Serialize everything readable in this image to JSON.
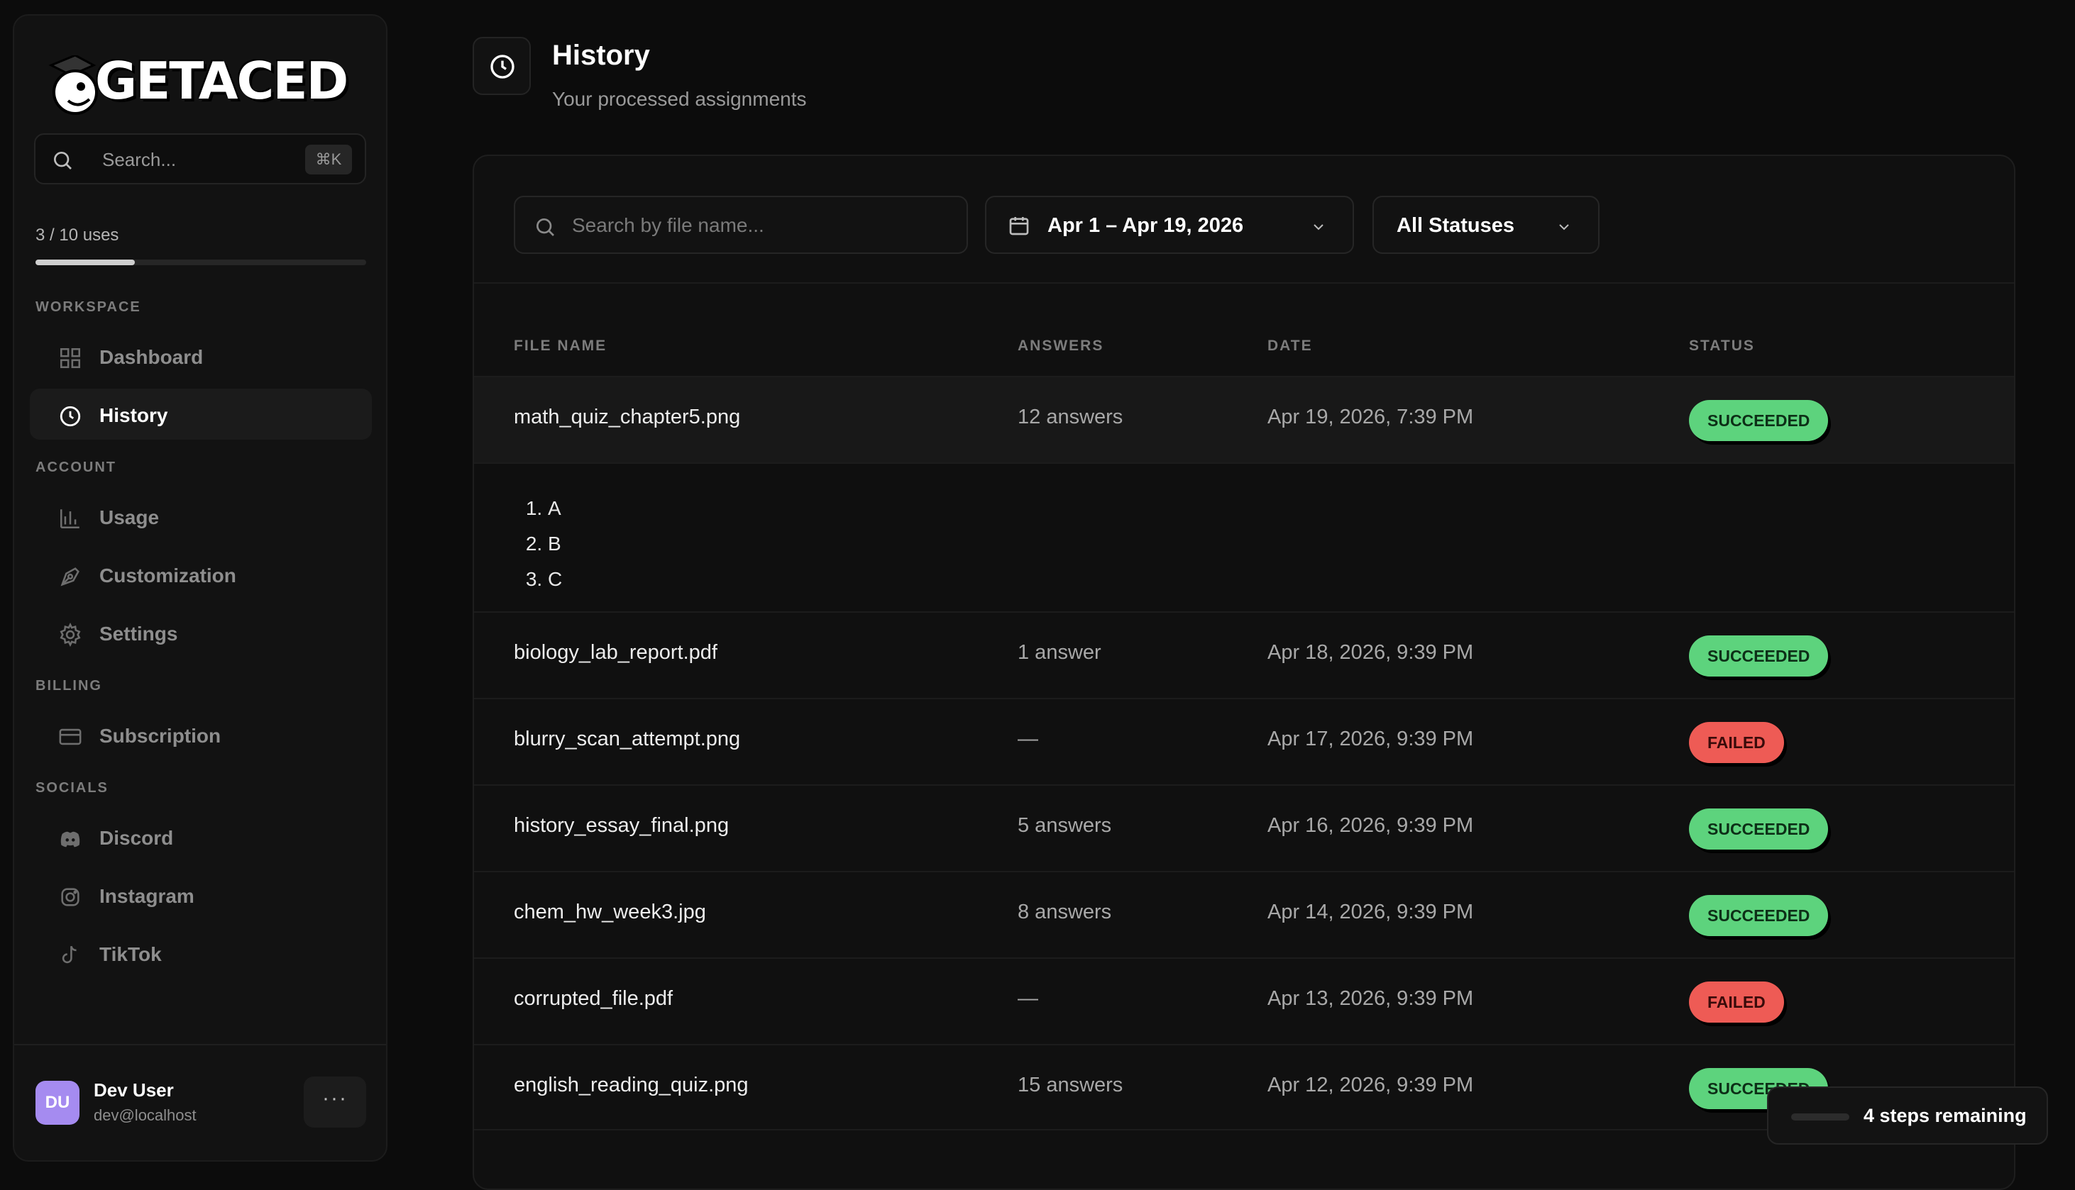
{
  "sidebar": {
    "logo_text": "GETACED",
    "search": {
      "placeholder": "Search...",
      "shortcut": "⌘K"
    },
    "usage": {
      "label": "3 / 10 uses",
      "used": 3,
      "total": 10
    },
    "sections": {
      "workspace": "WORKSPACE",
      "account": "ACCOUNT",
      "billing": "BILLING",
      "socials": "SOCIALS"
    },
    "items": {
      "dashboard": "Dashboard",
      "history": "History",
      "usage": "Usage",
      "customization": "Customization",
      "settings": "Settings",
      "subscription": "Subscription",
      "discord": "Discord",
      "instagram": "Instagram",
      "tiktok": "TikTok"
    },
    "user": {
      "initials": "DU",
      "name": "Dev User",
      "email": "dev@localhost",
      "menu": "···"
    }
  },
  "header": {
    "title": "History",
    "subtitle": "Your processed assignments",
    "icon": "clock-icon"
  },
  "filters": {
    "search_placeholder": "Search by file name...",
    "date_range": "Apr 1 – Apr 19, 2026",
    "status": "All Statuses"
  },
  "table": {
    "headers": {
      "file": "FILE NAME",
      "answers": "ANSWERS",
      "date": "DATE",
      "status": "STATUS"
    },
    "rows": [
      {
        "file": "math_quiz_chapter5.png",
        "answers": "12 answers",
        "date": "Apr 19, 2026, 7:39 PM",
        "status": "SUCCEEDED"
      },
      {
        "file": "biology_lab_report.pdf",
        "answers": "1 answer",
        "date": "Apr 18, 2026, 9:39 PM",
        "status": "SUCCEEDED"
      },
      {
        "file": "blurry_scan_attempt.png",
        "answers": "—",
        "date": "Apr 17, 2026, 9:39 PM",
        "status": "FAILED"
      },
      {
        "file": "history_essay_final.png",
        "answers": "5 answers",
        "date": "Apr 16, 2026, 9:39 PM",
        "status": "SUCCEEDED"
      },
      {
        "file": "chem_hw_week3.jpg",
        "answers": "8 answers",
        "date": "Apr 14, 2026, 9:39 PM",
        "status": "SUCCEEDED"
      },
      {
        "file": "corrupted_file.pdf",
        "answers": "—",
        "date": "Apr 13, 2026, 9:39 PM",
        "status": "FAILED"
      },
      {
        "file": "english_reading_quiz.png",
        "answers": "15 answers",
        "date": "Apr 12, 2026, 9:39 PM",
        "status": "SUCCEEDED"
      }
    ],
    "expanded_answers": [
      "A",
      "B",
      "C"
    ]
  },
  "onboarding": {
    "label": "4 steps remaining"
  },
  "colors": {
    "success": "#5dd37d",
    "failed": "#ee5b55",
    "avatar": "#a58bf0"
  }
}
